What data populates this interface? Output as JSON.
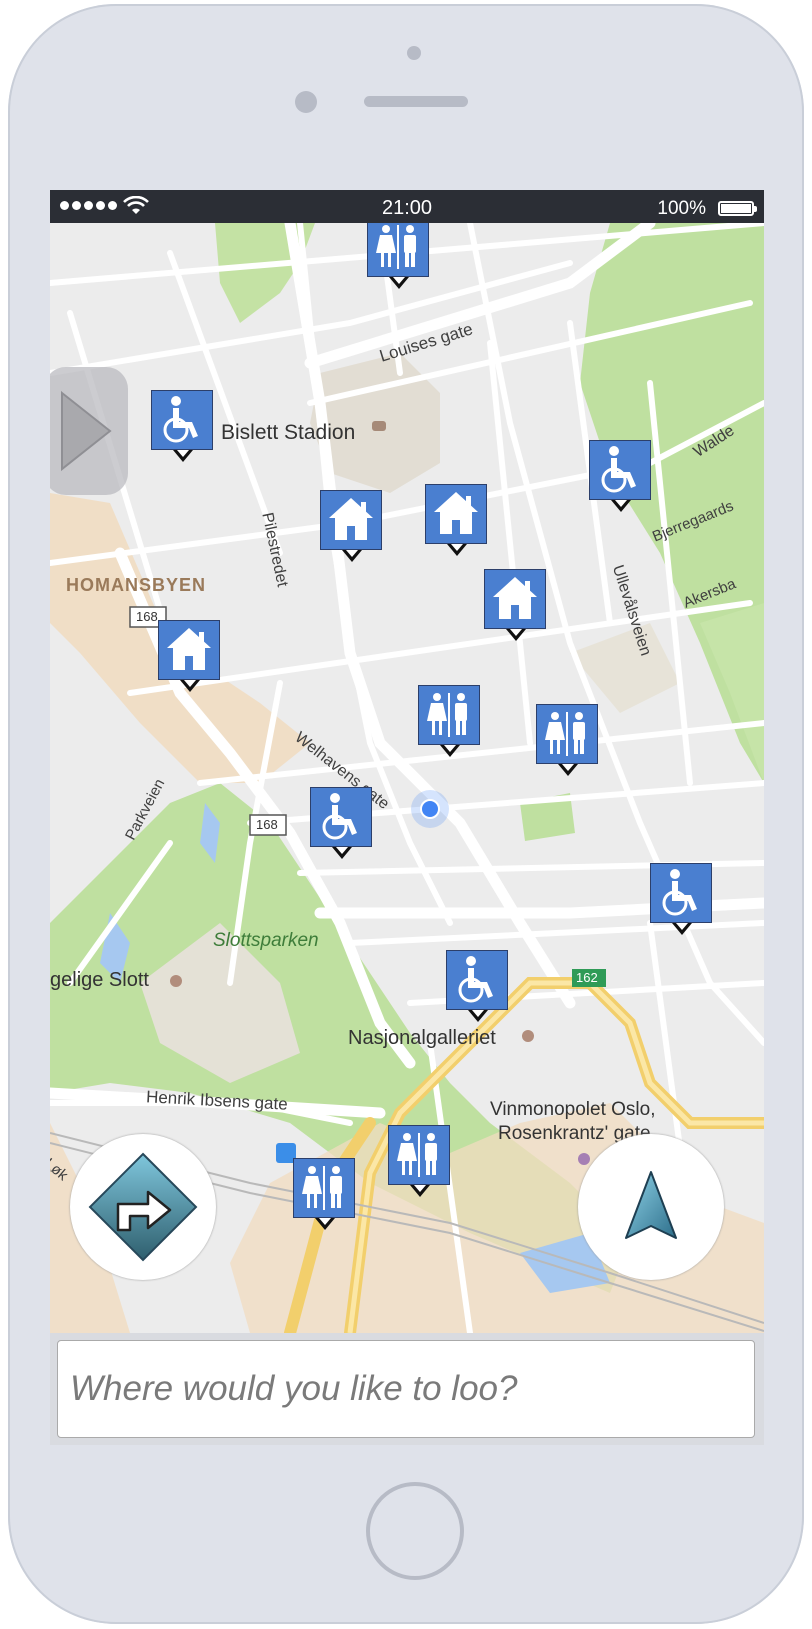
{
  "status_bar": {
    "time": "21:00",
    "battery_percent": "100%",
    "signal_bars": 5
  },
  "map": {
    "labels": {
      "louises_gate": "Louises gate",
      "bislett_stadion": "Bislett Stadion",
      "pilestredet": "Pilestredet",
      "waldemar": "Walde",
      "bjerregaards": "Bjerregaards",
      "akersbakken": "Akersba",
      "ullevalsveien": "Ullevålsveien",
      "homansbyen": "HOMANSBYEN",
      "route_168_a": "168",
      "route_168_b": "168",
      "welhavens_gate": "Welhavens gate",
      "parkveien": "Parkveien",
      "slottsparken": "Slottsparken",
      "slott": "gelige Slott",
      "route_162": "162",
      "nasjonalgalleriet": "Nasjonalgalleriet",
      "henrik_ibsens_gate": "Henrik Ibsens gate",
      "vinmonopolet": "Vinmonopolet Oslo,",
      "rosenkrantz": "Rosenkrantz' gate",
      "lokke": "Løk"
    },
    "markers": [
      {
        "type": "toilet",
        "icon": "toilet-icon"
      },
      {
        "type": "accessible",
        "icon": "wheelchair-icon"
      },
      {
        "type": "accessible",
        "icon": "wheelchair-icon"
      },
      {
        "type": "home",
        "icon": "home-icon"
      },
      {
        "type": "home",
        "icon": "home-icon"
      },
      {
        "type": "home",
        "icon": "home-icon"
      },
      {
        "type": "home",
        "icon": "home-icon"
      },
      {
        "type": "toilet",
        "icon": "toilet-icon"
      },
      {
        "type": "toilet",
        "icon": "toilet-icon"
      },
      {
        "type": "accessible",
        "icon": "wheelchair-icon"
      },
      {
        "type": "accessible",
        "icon": "wheelchair-icon"
      },
      {
        "type": "accessible",
        "icon": "wheelchair-icon"
      },
      {
        "type": "toilet",
        "icon": "toilet-icon"
      },
      {
        "type": "toilet",
        "icon": "toilet-icon"
      }
    ],
    "colors": {
      "marker": "#4a7fd0",
      "park": "#bfe0a0",
      "road_major": "#f8d77c",
      "user_location": "#4285f4"
    }
  },
  "controls": {
    "sidebar_toggle_icon": "play-triangle-icon",
    "directions_icon": "turn-right-diamond-icon",
    "locate_icon": "navigation-arrow-icon"
  },
  "search": {
    "placeholder": "Where would you like to loo?",
    "value": ""
  }
}
